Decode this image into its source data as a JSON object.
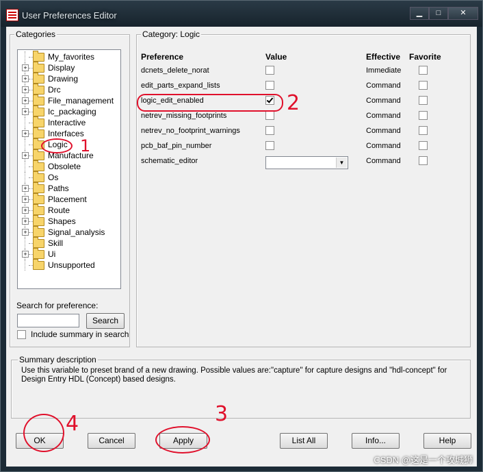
{
  "window": {
    "title": "User Preferences Editor",
    "controls": {
      "minimize": "▁",
      "maximize": "□",
      "close": "✕"
    }
  },
  "categories": {
    "label": "Categories",
    "items": [
      {
        "label": "My_favorites",
        "expandable": false
      },
      {
        "label": "Display",
        "expandable": true
      },
      {
        "label": "Drawing",
        "expandable": true
      },
      {
        "label": "Drc",
        "expandable": true
      },
      {
        "label": "File_management",
        "expandable": true
      },
      {
        "label": "Ic_packaging",
        "expandable": true
      },
      {
        "label": "Interactive",
        "expandable": false
      },
      {
        "label": "Interfaces",
        "expandable": true
      },
      {
        "label": "Logic",
        "expandable": false,
        "selected": true
      },
      {
        "label": "Manufacture",
        "expandable": true
      },
      {
        "label": "Obsolete",
        "expandable": false
      },
      {
        "label": "Os",
        "expandable": false
      },
      {
        "label": "Paths",
        "expandable": true
      },
      {
        "label": "Placement",
        "expandable": true
      },
      {
        "label": "Route",
        "expandable": true
      },
      {
        "label": "Shapes",
        "expandable": true
      },
      {
        "label": "Signal_analysis",
        "expandable": true
      },
      {
        "label": "Skill",
        "expandable": false
      },
      {
        "label": "Ui",
        "expandable": true
      },
      {
        "label": "Unsupported",
        "expandable": false
      }
    ]
  },
  "search": {
    "label": "Search for preference:",
    "value": "",
    "button": "Search",
    "include_summary_label": "Include summary in search",
    "include_summary_checked": false
  },
  "category_panel": {
    "label": "Category:  Logic",
    "headers": {
      "preference": "Preference",
      "value": "Value",
      "effective": "Effective",
      "favorite": "Favorite"
    },
    "rows": [
      {
        "name": "dcnets_delete_norat",
        "checked": false,
        "effective": "Immediate",
        "favorite": false
      },
      {
        "name": "edit_parts_expand_lists",
        "checked": false,
        "effective": "Command",
        "favorite": false
      },
      {
        "name": "logic_edit_enabled",
        "checked": true,
        "effective": "Command",
        "favorite": false
      },
      {
        "name": "netrev_missing_footprints",
        "checked": false,
        "effective": "Command",
        "favorite": false
      },
      {
        "name": "netrev_no_footprint_warnings",
        "checked": false,
        "effective": "Command",
        "favorite": false
      },
      {
        "name": "pcb_baf_pin_number",
        "checked": false,
        "effective": "Command",
        "favorite": false
      },
      {
        "name": "schematic_editor",
        "combo": true,
        "value": "",
        "effective": "Command",
        "favorite": false
      }
    ]
  },
  "summary": {
    "label": "Summary description",
    "text": "Use this variable to preset brand of a new drawing. Possible values are:\"capture\" for capture designs and \"hdl-concept\" for Design Entry HDL (Concept) based designs."
  },
  "buttons": {
    "ok": "OK",
    "cancel": "Cancel",
    "apply": "Apply",
    "list_all": "List All",
    "info": "Info...",
    "help": "Help"
  },
  "annotations": {
    "one": "1",
    "two": "2",
    "three": "3",
    "four": "4"
  },
  "watermark": "CSDN @这是一个攻城狮",
  "colors": {
    "annotation": "#e0102b",
    "folder": "#f7d46a",
    "frame": "#1c2b36"
  }
}
